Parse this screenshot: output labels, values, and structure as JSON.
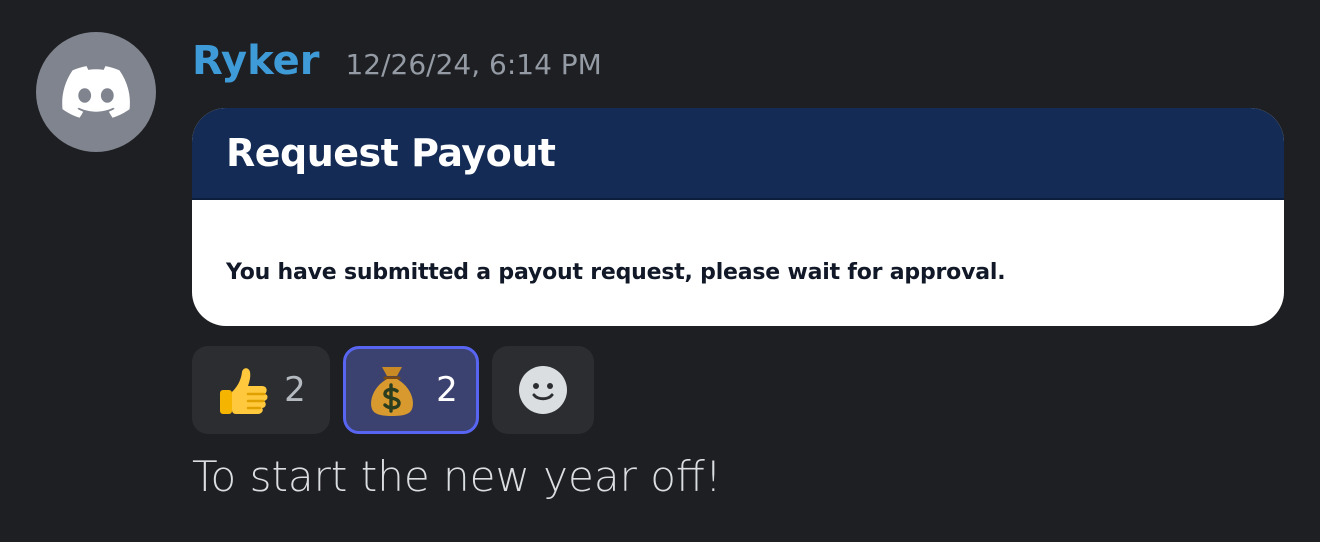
{
  "message": {
    "avatar_icon": "discord-logo-icon",
    "username": "Ryker",
    "timestamp": "12/26/24, 6:14 PM",
    "embed": {
      "title": "Request Payout",
      "description": "You have submitted a payout request, please wait for approval."
    },
    "reactions": [
      {
        "emoji": "thumbs-up-icon",
        "count": "2",
        "active": false
      },
      {
        "emoji": "money-bag-icon",
        "count": "2",
        "active": true
      },
      {
        "emoji": "add-reaction-icon",
        "count": "",
        "active": false
      }
    ],
    "text": "To start the new year off!"
  },
  "colors": {
    "background": "#1e1f22",
    "username": "#3e9bd8",
    "timestamp": "#949ba4",
    "embed_header": "#132b55",
    "reaction_active_border": "#5865f2"
  }
}
